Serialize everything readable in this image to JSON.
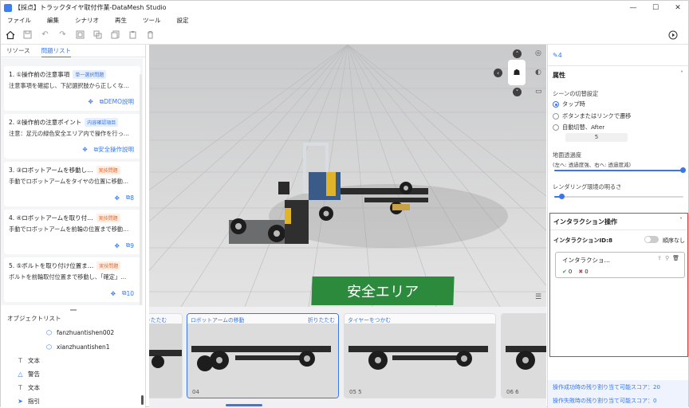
{
  "window": {
    "title": "【採点】トラックタイヤ取付作業-DataMesh Studio",
    "min": "—",
    "max": "☐",
    "close": "✕"
  },
  "menu": [
    "ファイル",
    "編集",
    "シナリオ",
    "再生",
    "ツール",
    "設定"
  ],
  "left_tabs": [
    "リソース",
    "問題リスト"
  ],
  "questions": [
    {
      "title": "1. ①操作前の注意事項",
      "badge": "単一選択問題",
      "desc": "注意事項を確認し、下記選択肢から正しくな…",
      "action": "DEMO説明"
    },
    {
      "title": "2. ②操作前の注意ポイント",
      "badge": "内容確認項目",
      "desc": "注意：足元の緑色安全エリア内で操作を行っ…",
      "action": "安全操作説明"
    },
    {
      "title": "3. ③ロボットアームを移動し…",
      "badge": "実技問題",
      "desc": "手動でロボットアームをタイヤの位置に移動…",
      "action": "8"
    },
    {
      "title": "4. ④ロボットアームを取り付…",
      "badge": "実技問題",
      "desc": "手動でロボットアームを前輪の位置まで移動…",
      "action": "9"
    },
    {
      "title": "5. ⑤ボルトを取り付け位置ま…",
      "badge": "実技問題",
      "desc": "ボルトを前輪取付位置まで移動し、「確定」…",
      "action": "10"
    }
  ],
  "object_list": {
    "header": "オブジェクトリスト",
    "items": [
      {
        "label": "fanzhuantishen002",
        "icon": "cube-icon"
      },
      {
        "label": "xianzhuantishen1",
        "icon": "cube-icon"
      },
      {
        "label": "文本",
        "icon": "text-icon"
      },
      {
        "label": "警告",
        "icon": "warning-icon"
      },
      {
        "label": "文本",
        "icon": "text-icon"
      },
      {
        "label": "指引",
        "icon": "guide-icon"
      }
    ]
  },
  "viewport": {
    "safe_area_label": "安全エリア"
  },
  "slides": [
    {
      "title": "りたたむ",
      "right": "",
      "num": ""
    },
    {
      "title": "ロボットアームの移動",
      "right": "折りたたむ",
      "num": "04"
    },
    {
      "title": "タイヤーをつかむ",
      "right": "",
      "num": "05  5"
    },
    {
      "title": "",
      "right": "",
      "num": "06  6"
    }
  ],
  "right": {
    "edit_count": "4",
    "attr_title": "属性",
    "scene_switch": "シーンの切替設定",
    "options": [
      "タップ時",
      "ボタンまたはリンクで遷移",
      "自動切替、After"
    ],
    "after_value": "5",
    "ground_title": "地面透過度",
    "ground_sub": "(左へ: 透過度強、右へ: 透過度減)",
    "ground_level": 1.0,
    "render_title": "レンダリング環境の明るさ",
    "render_level": 0.06,
    "inter_title": "インタラクション操作",
    "inter_id": "インタラクションID:8",
    "order_label": "順序なし",
    "card_title": "インタラクショ…",
    "ok_count": "0",
    "ng_count": "0",
    "score_ok_label": "操作成功時の残り割り当て可能スコア：",
    "score_ok": "20",
    "score_ng_label": "操作失敗時の残り割り当て可能スコア：",
    "score_ng": "0"
  },
  "colors": {
    "accent": "#3a76e8",
    "safe_green": "#2b8a3c",
    "highlight": "#e03a3a"
  }
}
